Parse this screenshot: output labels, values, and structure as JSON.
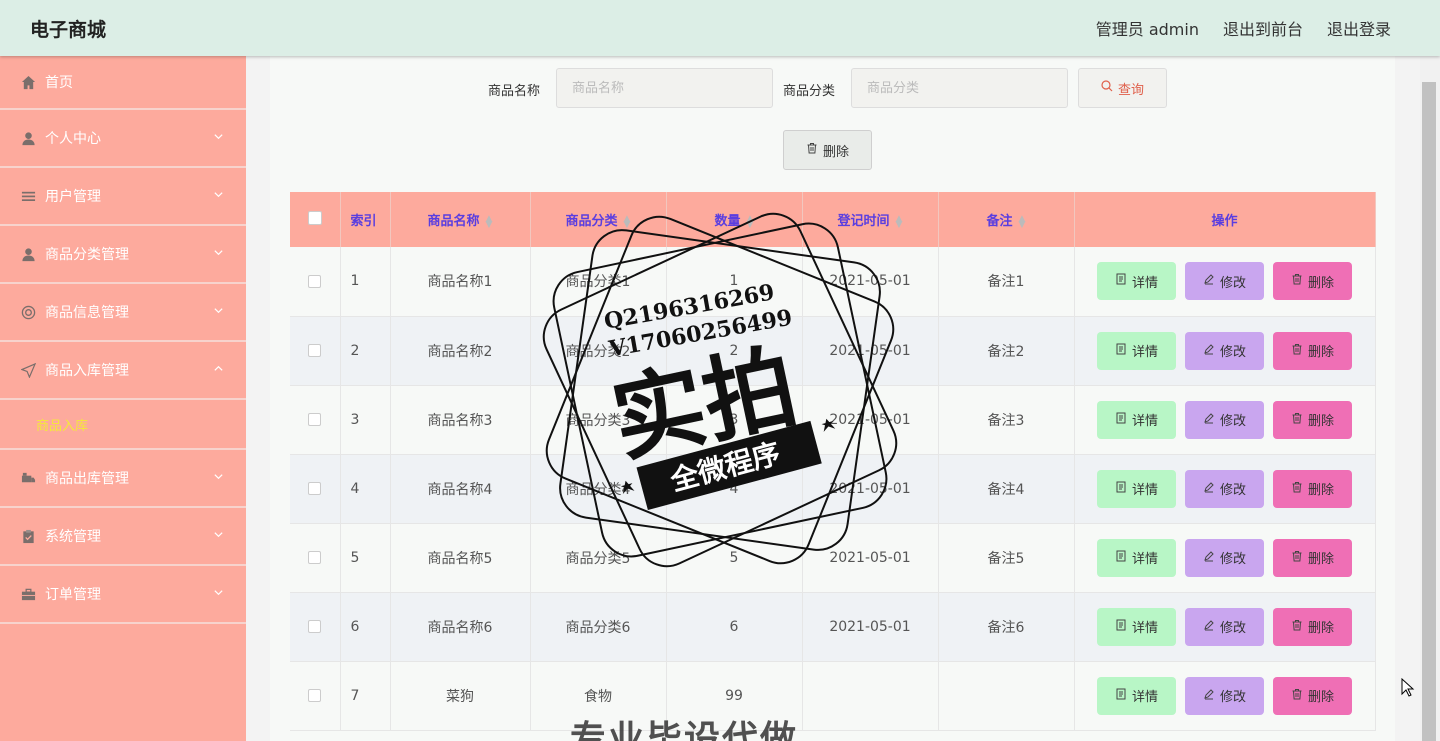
{
  "header": {
    "brand": "电子商城",
    "nav": [
      "管理员 admin",
      "退出到前台",
      "退出登录"
    ]
  },
  "sidebar": {
    "items": [
      {
        "label": "首页",
        "icon": "home-icon"
      },
      {
        "label": "个人中心",
        "icon": "user-icon"
      },
      {
        "label": "用户管理",
        "icon": "list-icon"
      },
      {
        "label": "商品分类管理",
        "icon": "user-icon"
      },
      {
        "label": "商品信息管理",
        "icon": "target-icon"
      },
      {
        "label": "商品入库管理",
        "icon": "send-icon"
      },
      {
        "label": "商品出库管理",
        "icon": "truck-icon"
      },
      {
        "label": "系统管理",
        "icon": "clipboard-icon"
      },
      {
        "label": "订单管理",
        "icon": "briefcase-icon"
      }
    ],
    "submenu_active": "商品入库"
  },
  "search": {
    "name_label": "商品名称",
    "name_placeholder": "商品名称",
    "category_label": "商品分类",
    "category_placeholder": "商品分类",
    "query_label": "查询",
    "batch_delete_label": "删除"
  },
  "table": {
    "headers": [
      "索引",
      "商品名称",
      "商品分类",
      "数量",
      "登记时间",
      "备注",
      "操作"
    ],
    "rows": [
      {
        "idx": "1",
        "name": "商品名称1",
        "category": "商品分类1",
        "qty": "1",
        "date": "2021-05-01",
        "note": "备注1"
      },
      {
        "idx": "2",
        "name": "商品名称2",
        "category": "商品分类2",
        "qty": "2",
        "date": "2021-05-01",
        "note": "备注2"
      },
      {
        "idx": "3",
        "name": "商品名称3",
        "category": "商品分类3",
        "qty": "3",
        "date": "2021-05-01",
        "note": "备注3"
      },
      {
        "idx": "4",
        "name": "商品名称4",
        "category": "商品分类4",
        "qty": "4",
        "date": "2021-05-01",
        "note": "备注4"
      },
      {
        "idx": "5",
        "name": "商品名称5",
        "category": "商品分类5",
        "qty": "5",
        "date": "2021-05-01",
        "note": "备注5"
      },
      {
        "idx": "6",
        "name": "商品名称6",
        "category": "商品分类6",
        "qty": "6",
        "date": "2021-05-01",
        "note": "备注6"
      },
      {
        "idx": "7",
        "name": "菜狗",
        "category": "食物",
        "qty": "99",
        "date": "",
        "note": ""
      }
    ],
    "actions": {
      "detail": "详情",
      "edit": "修改",
      "delete": "删除"
    }
  },
  "watermark": {
    "line1": "Q2196316269",
    "line2": "V17060256499",
    "big": "实拍",
    "banner": "全微程序",
    "bottom": "专业毕设代做"
  },
  "colors": {
    "header_bg": "#dceee6",
    "sidebar_bg": "#fdaa9d",
    "table_header_bg": "#fdaa9d",
    "table_header_text": "#5a3ee0",
    "detail_btn": "#b8f6c6",
    "edit_btn": "#c9a6ef",
    "delete_btn": "#ef6fb5",
    "submenu_active": "#f5e83a"
  }
}
